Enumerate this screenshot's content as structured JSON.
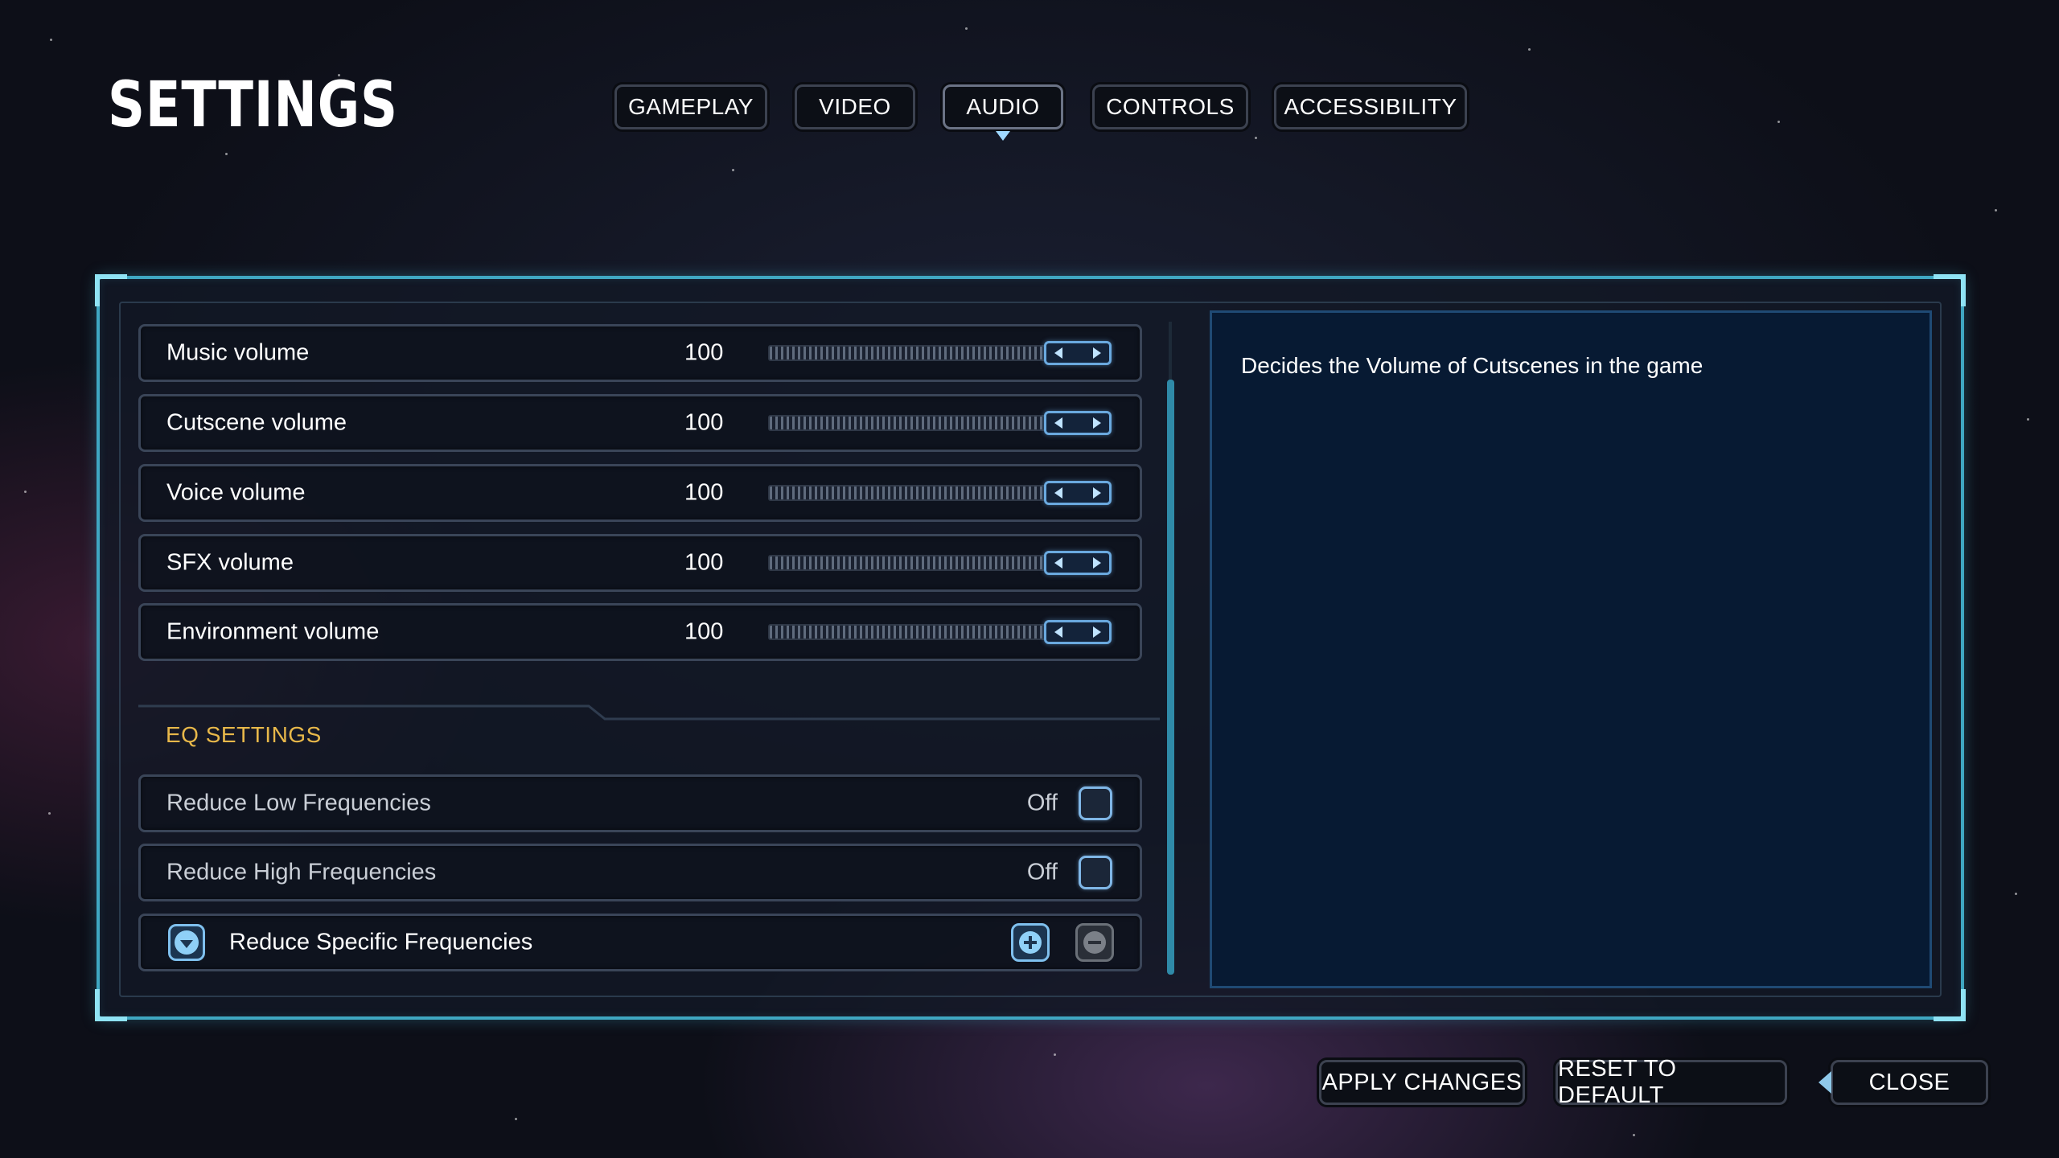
{
  "page_title": "SETTINGS",
  "tabs": [
    {
      "label": "GAMEPLAY",
      "active": false
    },
    {
      "label": "VIDEO",
      "active": false
    },
    {
      "label": "AUDIO",
      "active": true
    },
    {
      "label": "CONTROLS",
      "active": false
    },
    {
      "label": "ACCESSIBILITY",
      "active": false
    }
  ],
  "volume_settings": [
    {
      "label": "Music volume",
      "value": "100",
      "level": 1.0
    },
    {
      "label": "Cutscene volume",
      "value": "100",
      "level": 1.0
    },
    {
      "label": "Voice volume",
      "value": "100",
      "level": 1.0
    },
    {
      "label": "SFX volume",
      "value": "100",
      "level": 1.0
    },
    {
      "label": "Environment volume",
      "value": "100",
      "level": 1.0
    }
  ],
  "eq": {
    "heading": "EQ SETTINGS",
    "toggles": [
      {
        "label": "Reduce Low Frequencies",
        "value": "Off"
      },
      {
        "label": "Reduce High Frequencies",
        "value": "Off"
      }
    ],
    "specific": {
      "label": "Reduce Specific Frequencies"
    }
  },
  "description": "Decides the Volume of Cutscenes in the game",
  "buttons": {
    "apply": "APPLY CHANGES",
    "reset": "RESET TO DEFAULT",
    "close": "CLOSE"
  },
  "colors": {
    "accent": "#3fa7c2",
    "eq_heading": "#e8b84a",
    "handle_border": "#6aa9df",
    "description_bg": "#071a33"
  },
  "icons": {
    "slider_left": "chevron-left-icon",
    "slider_right": "chevron-right-icon",
    "expand": "chevron-down-icon",
    "add": "plus-icon",
    "remove": "minus-icon"
  }
}
